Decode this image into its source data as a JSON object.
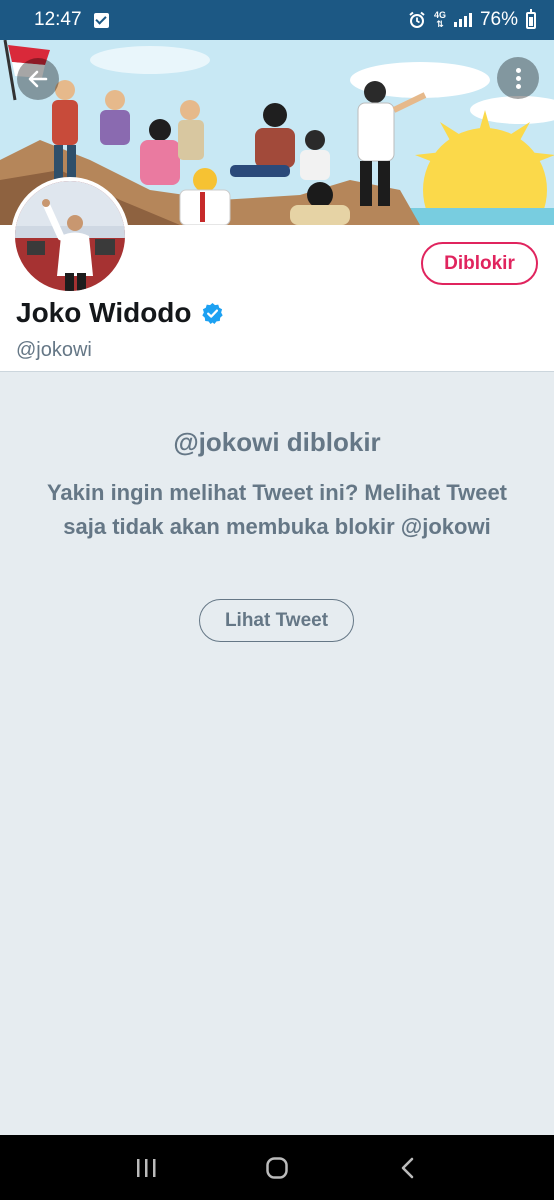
{
  "status_bar": {
    "time": "12:47",
    "network": "4G",
    "battery": "76%"
  },
  "icons": {
    "back": "arrow-left-icon",
    "more": "more-vertical-icon",
    "verified": "verified-badge-icon",
    "recents": "recent-apps-icon",
    "home": "home-icon",
    "nav_back": "nav-back-icon"
  },
  "colors": {
    "accent": "#1da1f2",
    "blocked": "#e0245e",
    "muted_text": "#657786",
    "status_bar": "#1c5884",
    "background": "#e6ecf0"
  },
  "profile": {
    "name": "Joko Widodo",
    "handle": "@jokowi",
    "blocked_button": "Diblokir"
  },
  "notice": {
    "title": "@jokowi diblokir",
    "body": "Yakin ingin melihat Tweet ini? Melihat Tweet saja tidak akan membuka blokir @jokowi",
    "view_button": "Lihat Tweet"
  }
}
